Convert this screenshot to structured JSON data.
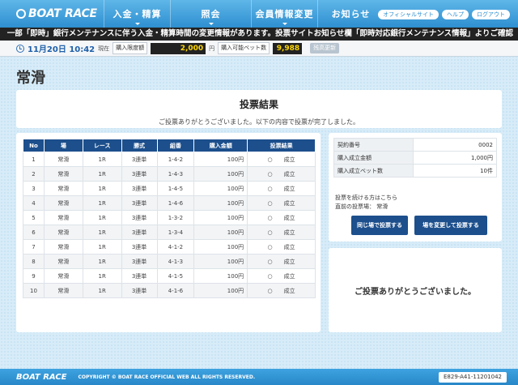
{
  "header": {
    "logo": "BOAT RACE",
    "menu": [
      "入金・精算",
      "照会",
      "会員情報変更",
      "お知らせ"
    ],
    "utility": [
      "オフィシャルサイト",
      "ヘルプ",
      "ログアウト"
    ]
  },
  "notice": "一部「即時」銀行メンテナンスに伴う入金・精算時間の変更情報があります。投票サイトお知らせ欄「即時対応銀行メンテナンス情報」よりご確認",
  "status": {
    "datetime": "11月20日 10:42",
    "now_label": "現在",
    "limit_label": "購入限度額",
    "limit_value": "2,000",
    "yen": "円",
    "bets_label": "購入可能ベット数",
    "bets_value": "9,988",
    "reload": "残高更新"
  },
  "page_title": "常滑",
  "result": {
    "heading": "投票結果",
    "message": "ご投票ありがとうございました。以下の内容で投票が完了しました。"
  },
  "table": {
    "headers": [
      "No",
      "場",
      "レース",
      "勝式",
      "組番",
      "購入金額",
      "投票結果"
    ],
    "rows": [
      [
        "1",
        "常滑",
        "1R",
        "3連単",
        "1-4-2",
        "100円",
        "成立"
      ],
      [
        "2",
        "常滑",
        "1R",
        "3連単",
        "1-4-3",
        "100円",
        "成立"
      ],
      [
        "3",
        "常滑",
        "1R",
        "3連単",
        "1-4-5",
        "100円",
        "成立"
      ],
      [
        "4",
        "常滑",
        "1R",
        "3連単",
        "1-4-6",
        "100円",
        "成立"
      ],
      [
        "5",
        "常滑",
        "1R",
        "3連単",
        "1-3-2",
        "100円",
        "成立"
      ],
      [
        "6",
        "常滑",
        "1R",
        "3連単",
        "1-3-4",
        "100円",
        "成立"
      ],
      [
        "7",
        "常滑",
        "1R",
        "3連単",
        "4-1-2",
        "100円",
        "成立"
      ],
      [
        "8",
        "常滑",
        "1R",
        "3連単",
        "4-1-3",
        "100円",
        "成立"
      ],
      [
        "9",
        "常滑",
        "1R",
        "3連単",
        "4-1-5",
        "100円",
        "成立"
      ],
      [
        "10",
        "常滑",
        "1R",
        "3連単",
        "4-1-6",
        "100円",
        "成立"
      ]
    ],
    "result_mark": "○"
  },
  "summary": {
    "rows": [
      {
        "label": "契約番号",
        "value": "0002"
      },
      {
        "label": "購入成立金額",
        "value": "1,000円"
      },
      {
        "label": "購入成立ベット数",
        "value": "10件"
      }
    ],
    "continue_text": "投票を続ける方はこちら",
    "last_venue": "直前の投票場： 常滑",
    "btn_same": "同じ場で投票する",
    "btn_change": "場を変更して投票する"
  },
  "thanks": "ご投票ありがとうございました。",
  "footer": {
    "logo": "BOAT RACE",
    "copyright": "COPYRIGHT © BOAT RACE OFFICIAL WEB ALL RIGHTS RESERVED.",
    "code": "E829-A41-11201042"
  }
}
